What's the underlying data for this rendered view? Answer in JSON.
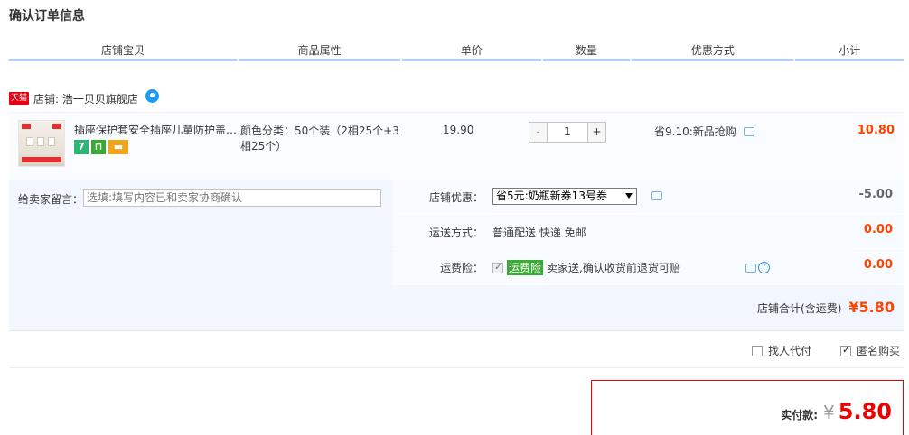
{
  "section_title": "确认订单信息",
  "columns": [
    "店铺宝贝",
    "商品属性",
    "单价",
    "数量",
    "优惠方式",
    "小计"
  ],
  "shop": {
    "badge": "天猫",
    "label": "店铺: 浩一贝贝旗舰店"
  },
  "item": {
    "title": "插座保护套安全插座儿童防护盖…",
    "attr": "颜色分类：50个装（2相25个+3相25个）",
    "price": "19.90",
    "qty_minus": "-",
    "qty": "1",
    "qty_plus": "+",
    "promo": "省9.10:新品抢购",
    "subtotal": "10.80",
    "service_icons": [
      "seven-day-return-icon",
      "shopping-bag-icon",
      "credit-card-icon"
    ],
    "seven_label": "7"
  },
  "message": {
    "label": "给卖家留言：",
    "placeholder": "选填:填写内容已和卖家协商确认"
  },
  "shop_coupon": {
    "label": "店铺优惠：",
    "selected": "省5元:奶瓶新券13号券",
    "amount": "-5.00"
  },
  "shipping": {
    "label": "运送方式：",
    "value": "普通配送 快递 免邮",
    "amount": "0.00"
  },
  "insurance": {
    "label": "运费险：",
    "tag": "运费险",
    "text": "卖家送,确认收货前退货可赔",
    "amount": "0.00",
    "help": "?"
  },
  "shop_total": {
    "label": "店铺合计(含运费)",
    "amount": "¥5.80"
  },
  "options": {
    "find_payer": "找人代付",
    "anonymous": "匿名购买",
    "find_payer_checked": false,
    "anonymous_checked": true
  },
  "payment": {
    "label": "实付款:",
    "currency": "¥",
    "amount": "5.80"
  },
  "colors": {
    "accent_red": "#ff4400",
    "header_border": "#b2d1ff",
    "panel_bg": "#f2f7ff"
  }
}
